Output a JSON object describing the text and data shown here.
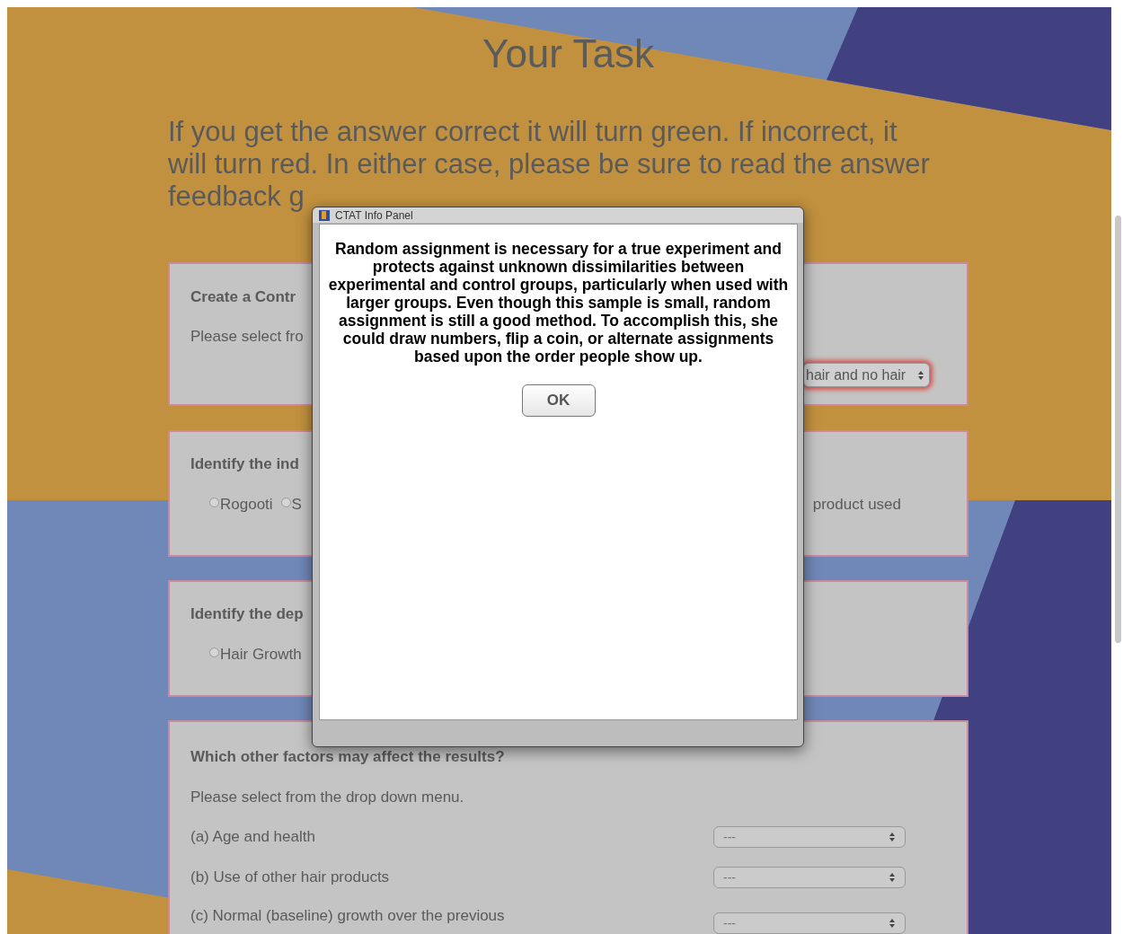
{
  "page": {
    "title": "Your Task",
    "instructions": "If you get the answer correct it will turn green. If incorrect, it will turn red. In either case, please be sure to read the answer feedback g"
  },
  "cards": [
    {
      "kind": "select",
      "title": "Create a Contr",
      "prompt": "Please select fro",
      "select_value": "hair and no hair",
      "highlighted": true
    },
    {
      "kind": "radio",
      "title": "Identify the ind",
      "options": [
        {
          "label": "Rogooti",
          "selected": false
        },
        {
          "label": "S",
          "selected": false
        }
      ],
      "right_label": "product used"
    },
    {
      "kind": "radio",
      "title": "Identify the dep",
      "options": [
        {
          "label": "Hair Growth",
          "selected": false
        }
      ]
    }
  ],
  "factors": {
    "title": "Which other factors may affect the results?",
    "prompt": "Please select from the drop down menu.",
    "rows": [
      {
        "label": "(a) Age and health",
        "value": "---"
      },
      {
        "label": "(b) Use of other hair products",
        "value": "---"
      },
      {
        "label": "(c) Normal (baseline) growth over the previous",
        "value": "---"
      }
    ]
  },
  "dialog": {
    "title": "CTAT Info Panel",
    "message": "Random assignment is necessary for a true experiment and protects against unknown dissimilarities between experimental and control groups, particularly when used with larger groups. Even though this sample is small, random assignment is still a good method. To accomplish this, she could draw numbers, flip a coin, or alternate assignments based upon the order people show up.",
    "button": "OK"
  }
}
